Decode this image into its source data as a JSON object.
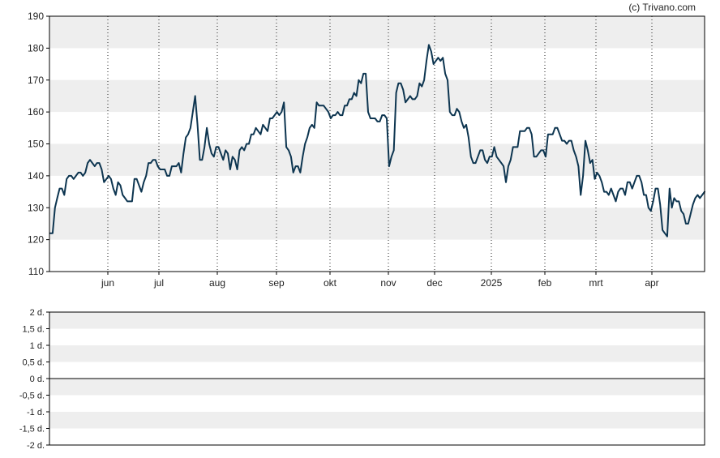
{
  "credit": "(c) Trivano.com",
  "colors": {
    "line": "#0d3550",
    "band": "#eeeeee",
    "grid": "#222222",
    "axis": "#000000"
  },
  "chart_data": [
    {
      "type": "line",
      "title": "",
      "xlabel": "",
      "ylabel": "",
      "ylim": [
        110,
        190
      ],
      "y_ticks": [
        110,
        120,
        130,
        140,
        150,
        160,
        170,
        180,
        190
      ],
      "y_tick_labels": [
        "110",
        "120",
        "130",
        "140",
        "150",
        "160",
        "170",
        "180",
        "190"
      ],
      "x_ticks": [
        "jun",
        "jul",
        "aug",
        "sep",
        "okt",
        "nov",
        "dec",
        "2025",
        "feb",
        "mrt",
        "apr"
      ],
      "grid": "vertical dotted at month ticks, alternating horizontal bands",
      "series": [
        {
          "values": [
            122,
            122,
            130,
            133,
            136,
            136,
            134,
            139,
            140,
            140,
            139,
            140,
            141,
            141,
            140,
            141,
            144,
            145,
            144,
            143,
            144,
            144,
            142,
            138,
            139,
            140,
            139,
            136,
            134,
            138,
            137,
            134,
            133,
            132,
            132,
            132,
            139,
            139,
            137,
            135,
            138,
            140,
            144,
            144,
            145,
            145,
            143,
            142,
            142,
            142,
            140,
            140,
            143,
            143,
            143,
            144,
            141,
            147,
            152,
            153,
            155,
            160,
            165,
            156,
            145,
            145,
            149,
            155,
            150,
            147,
            146,
            149,
            149,
            147,
            145,
            148,
            147,
            142,
            146,
            145,
            142,
            148,
            149,
            148,
            150,
            150,
            153,
            153,
            155,
            154,
            153,
            156,
            155,
            154,
            158,
            158,
            159,
            160,
            159,
            160,
            163,
            149,
            148,
            146,
            141,
            143,
            143,
            141,
            146,
            150,
            152,
            155,
            156,
            155,
            163,
            162,
            162,
            162,
            161,
            160,
            158,
            159,
            159,
            160,
            159,
            159,
            162,
            162,
            164,
            164,
            166,
            165,
            170,
            169,
            172,
            172,
            160,
            158,
            158,
            158,
            157,
            157,
            159,
            159,
            158,
            143,
            146,
            148,
            166,
            169,
            169,
            167,
            163,
            164,
            165,
            164,
            164,
            165,
            169,
            168,
            170,
            176,
            181,
            179,
            175,
            176,
            177,
            176,
            177,
            172,
            170,
            160,
            159,
            159,
            161,
            160,
            157,
            155,
            156,
            152,
            146,
            144,
            144,
            146,
            148,
            148,
            145,
            144,
            146,
            146,
            149,
            146,
            145,
            144,
            143,
            138,
            143,
            145,
            149,
            149,
            149,
            154,
            154,
            154,
            155,
            155,
            153,
            146,
            146,
            147,
            148,
            148,
            146,
            153,
            153,
            153,
            155,
            155,
            153,
            151,
            151,
            150,
            151,
            151,
            148,
            146,
            143,
            134,
            140,
            151,
            148,
            144,
            145,
            139,
            141,
            140,
            138,
            135,
            135,
            134,
            136,
            134,
            132,
            135,
            136,
            136,
            134,
            138,
            138,
            136,
            138,
            140,
            140,
            138,
            134,
            134,
            130,
            129,
            132,
            136,
            136,
            131,
            123,
            122,
            121,
            136,
            130,
            133,
            132,
            132,
            129,
            128,
            125,
            125,
            128,
            131,
            133,
            134,
            133,
            134,
            135
          ],
          "color": "#0d3550"
        }
      ]
    },
    {
      "type": "bar",
      "title": "",
      "xlabel": "",
      "ylabel": "",
      "ylim": [
        -2,
        2
      ],
      "y_ticks": [
        -2,
        -1.5,
        -1,
        -0.5,
        0,
        0.5,
        1,
        1.5,
        2
      ],
      "y_tick_labels": [
        "-2 d.",
        "-1,5 d.",
        "-1 d.",
        "-0,5 d.",
        "0 d.",
        "0,5 d.",
        "1 d.",
        "1,5 d.",
        "2 d."
      ],
      "values": []
    }
  ]
}
